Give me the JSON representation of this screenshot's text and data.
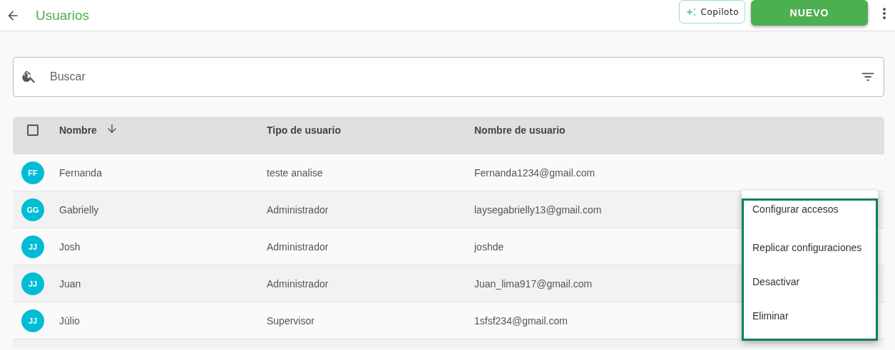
{
  "header": {
    "title": "Usuarios",
    "copilot_label": "Copiloto",
    "new_label": "NUEVO"
  },
  "search": {
    "placeholder": "Buscar"
  },
  "table": {
    "select_all_checked": false,
    "columns": [
      {
        "label": "Nombre",
        "sorted": true
      },
      {
        "label": "Tipo de usuario",
        "sorted": false
      },
      {
        "label": "Nombre de usuario",
        "sorted": false
      }
    ],
    "rows": [
      {
        "initials": "FF",
        "name": "Fernanda",
        "type": "teste analise",
        "username": "Fernanda1234@gmail.com"
      },
      {
        "initials": "GG",
        "name": "Gabrielly",
        "type": "Administrador",
        "username": "laysegabrielly13@gmail.com"
      },
      {
        "initials": "JJ",
        "name": "Josh",
        "type": "Administrador",
        "username": "joshde"
      },
      {
        "initials": "JJ",
        "name": "Juan",
        "type": "Administrador",
        "username": "Juan_lima917@gmail.com"
      },
      {
        "initials": "JJ",
        "name": "Júlio",
        "type": "Supervisor",
        "username": "1sfsf234@gmail.com"
      }
    ]
  },
  "context_menu": {
    "items": [
      "Configurar accesos",
      "Replicar configuraciones",
      "Desactivar",
      "Eliminar"
    ]
  }
}
